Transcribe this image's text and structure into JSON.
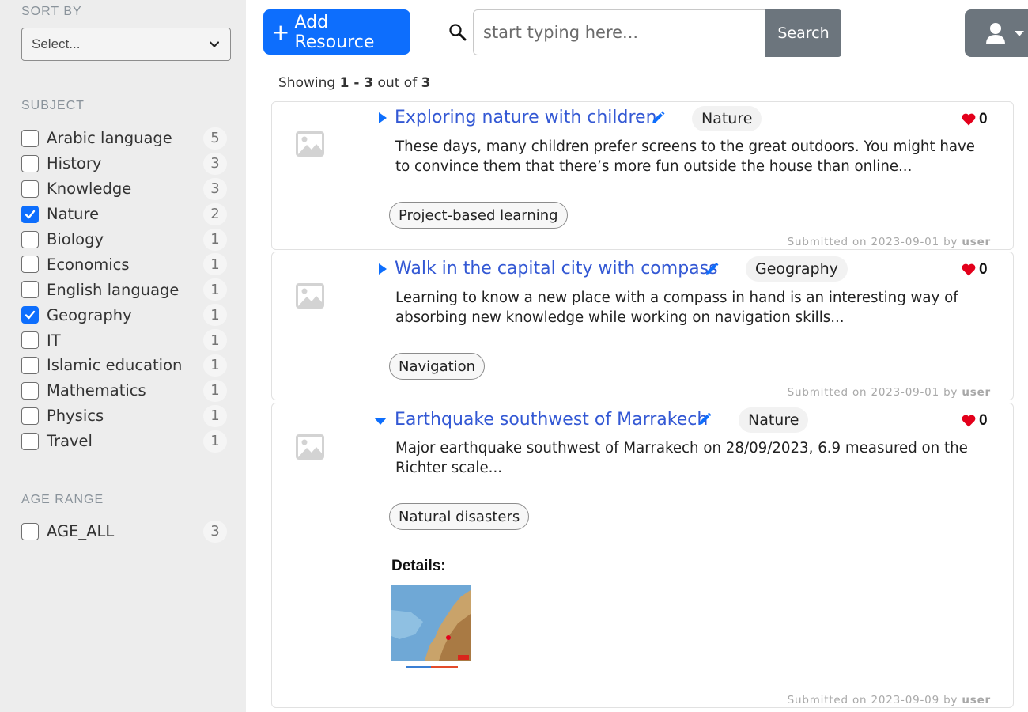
{
  "sidebar": {
    "sort_title": "SORT BY",
    "sort_placeholder": "Select...",
    "subject_title": "SUBJECT",
    "subjects": [
      {
        "label": "Arabic language",
        "count": "5",
        "checked": false
      },
      {
        "label": "History",
        "count": "3",
        "checked": false
      },
      {
        "label": "Knowledge",
        "count": "3",
        "checked": false
      },
      {
        "label": "Nature",
        "count": "2",
        "checked": true
      },
      {
        "label": "Biology",
        "count": "1",
        "checked": false
      },
      {
        "label": "Economics",
        "count": "1",
        "checked": false
      },
      {
        "label": "English language",
        "count": "1",
        "checked": false
      },
      {
        "label": "Geography",
        "count": "1",
        "checked": true
      },
      {
        "label": "IT",
        "count": "1",
        "checked": false
      },
      {
        "label": "Islamic education",
        "count": "1",
        "checked": false
      },
      {
        "label": "Mathematics",
        "count": "1",
        "checked": false
      },
      {
        "label": "Physics",
        "count": "1",
        "checked": false
      },
      {
        "label": "Travel",
        "count": "1",
        "checked": false
      }
    ],
    "age_title": "AGE RANGE",
    "ages": [
      {
        "label": "AGE_ALL",
        "count": "3",
        "checked": false
      }
    ]
  },
  "toolbar": {
    "add_label": "Add Resource",
    "add_plus": "+",
    "search_placeholder": "start typing here...",
    "search_label": "Search"
  },
  "results": {
    "showing_prefix": "Showing",
    "range": "1 - 3",
    "out_of": "out of",
    "total": "3"
  },
  "resources": [
    {
      "title": "Exploring nature with children",
      "subject": "Nature",
      "likes": "0",
      "description": "These days, many children prefer screens to the great outdoors. You might have to convince them that there’s more fun outside the house than online...",
      "tag": "Project-based learning",
      "submitted_prefix": "Submitted on",
      "date": "2023-09-01",
      "by": "by",
      "user": "user",
      "expanded": false
    },
    {
      "title": "Walk in the capital city with compass",
      "subject": "Geography",
      "likes": "0",
      "description": "Learning to know a new place with a compass in hand is an interesting way of absorbing new knowledge while working on navigation skills...",
      "tag": "Navigation",
      "submitted_prefix": "Submitted on",
      "date": "2023-09-01",
      "by": "by",
      "user": "user",
      "expanded": false
    },
    {
      "title": "Earthquake southwest of Marrakech",
      "subject": "Nature",
      "likes": "0",
      "description": "Major earthquake southwest of Marrakech on 28/09/2023, 6.9 measured on the Richter scale...",
      "tag": "Natural disasters",
      "details_label": "Details:",
      "submitted_prefix": "Submitted on",
      "date": "2023-09-09",
      "by": "by",
      "user": "user",
      "expanded": true
    }
  ],
  "colors": {
    "primary": "#0d6efd",
    "secondary": "#6c757d",
    "link": "#3358d4",
    "heart": "#e3001b",
    "sidebar_bg": "#ededed"
  },
  "icons": [
    "chevron-down-icon",
    "plus-icon",
    "search-icon",
    "user-icon",
    "caret-right-icon",
    "caret-down-icon",
    "pencil-icon",
    "heart-icon",
    "image-placeholder-icon"
  ]
}
